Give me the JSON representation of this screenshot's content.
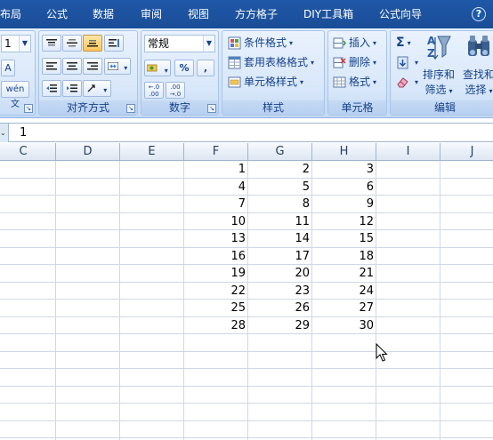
{
  "tabs": [
    {
      "label": "布局"
    },
    {
      "label": "公式"
    },
    {
      "label": "数据"
    },
    {
      "label": "审阅"
    },
    {
      "label": "视图"
    },
    {
      "label": "方方格子"
    },
    {
      "label": "DIY工具箱"
    },
    {
      "label": "公式向导"
    }
  ],
  "help_label": "?",
  "font": {
    "size_value": "1",
    "grow_label": "A",
    "phonetic_label": "wén 文"
  },
  "alignment": {
    "title": "对齐方式"
  },
  "number": {
    "title": "数字",
    "format_value": "常规",
    "percent_label": "%",
    "comma_label": ",",
    "inc_decimal_label": "←.0 .00",
    "dec_decimal_label": ".00 →.0"
  },
  "styles": {
    "title": "样式",
    "conditional_label": "条件格式",
    "table_format_label": "套用表格格式",
    "cell_style_label": "单元格样式"
  },
  "cells": {
    "title": "单元格",
    "insert_label": "插入",
    "delete_label": "删除",
    "format_label": "格式"
  },
  "editing": {
    "title": "编辑",
    "sort_label_1": "排序和",
    "sort_label_2": "筛选",
    "find_label_1": "查找和",
    "find_label_2": "选择"
  },
  "formula_bar": {
    "value": "1"
  },
  "columns": [
    "C",
    "D",
    "E",
    "F",
    "G",
    "H",
    "I",
    "J"
  ],
  "table": {
    "rows": [
      [
        1,
        2,
        3
      ],
      [
        4,
        5,
        6
      ],
      [
        7,
        8,
        9
      ],
      [
        10,
        11,
        12
      ],
      [
        13,
        14,
        15
      ],
      [
        16,
        17,
        18
      ],
      [
        19,
        20,
        21
      ],
      [
        22,
        23,
        24
      ],
      [
        25,
        26,
        27
      ],
      [
        28,
        29,
        30
      ]
    ]
  },
  "colors": {
    "tab_bar": "#1f58a8",
    "ribbon_text": "#15428b",
    "gridline": "#d0d7e5",
    "header_border": "#9eb6ce"
  }
}
